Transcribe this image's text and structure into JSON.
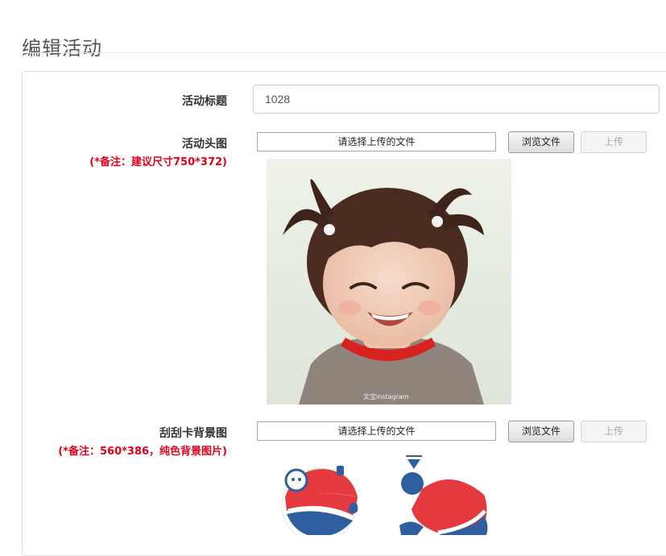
{
  "page": {
    "title": "编辑活动"
  },
  "form": {
    "title_field": {
      "label": "活动标题",
      "value": "1028"
    },
    "head_image": {
      "label": "活动头图",
      "note": "(*备注：建议尺寸750*372)",
      "file_placeholder": "请选择上传的文件",
      "browse_label": "浏览文件",
      "upload_label": "上传",
      "watermark": "文宝instagram"
    },
    "scratch_bg": {
      "label": "刮刮卡背景图",
      "note": "(*备注：560*386，纯色背景图片)",
      "file_placeholder": "请选择上传的文件",
      "browse_label": "浏览文件",
      "upload_label": "上传"
    }
  },
  "colors": {
    "note_red": "#e4001b",
    "pepsi_red": "#e3393f",
    "pepsi_blue": "#2f5f9e"
  }
}
